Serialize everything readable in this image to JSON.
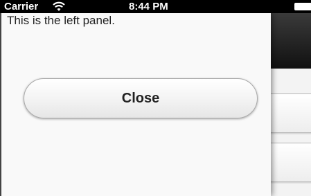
{
  "status_bar": {
    "carrier": "Carrier",
    "time": "8:44 PM",
    "wifi_icon": "wifi-icon",
    "battery_icon": "battery-icon"
  },
  "left_panel": {
    "text": "This is the left panel.",
    "close_label": "Close"
  },
  "colors": {
    "status_bar_bg": "#000000",
    "panel_bg": "#f9f9f9",
    "page_header_bg": "#1a1a1a"
  }
}
